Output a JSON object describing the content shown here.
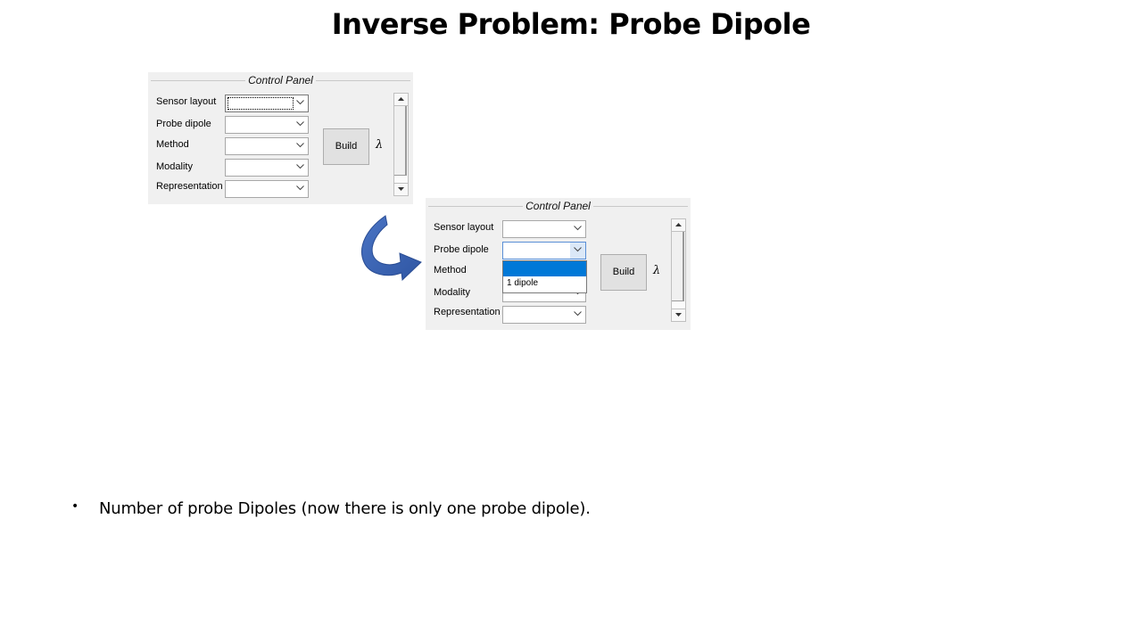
{
  "slide": {
    "title": "Inverse Problem: Probe Dipole",
    "bullet_marker": "•",
    "bullet_text": "Number of probe Dipoles (now there is only one probe dipole)."
  },
  "panel_before": {
    "title": "Control Panel",
    "rows": [
      {
        "label": "Sensor layout",
        "value": ""
      },
      {
        "label": "Probe dipole",
        "value": ""
      },
      {
        "label": "Method",
        "value": ""
      },
      {
        "label": "Modality",
        "value": ""
      },
      {
        "label": "Representation",
        "value": ""
      }
    ],
    "build_label": "Build",
    "lambda_symbol": "λ"
  },
  "panel_after": {
    "title": "Control Panel",
    "rows": [
      {
        "label": "Sensor layout",
        "value": ""
      },
      {
        "label": "Probe dipole",
        "value": ""
      },
      {
        "label": "Method",
        "value": ""
      },
      {
        "label": "Modality",
        "value": ""
      },
      {
        "label": "Representation",
        "value": ""
      }
    ],
    "build_label": "Build",
    "lambda_symbol": "λ",
    "dropdown_options": [
      "",
      "1 dipole"
    ]
  },
  "icons": {
    "combo_arrow": "chevron-down-icon",
    "scroll_up": "triangle-up-icon",
    "scroll_down": "triangle-down-icon",
    "transition_arrow": "curved-arrow-icon"
  },
  "colors": {
    "selection_highlight": "#0078d7",
    "arrow_fill": "#3a62ad",
    "panel_bg": "#f0f0f0"
  }
}
